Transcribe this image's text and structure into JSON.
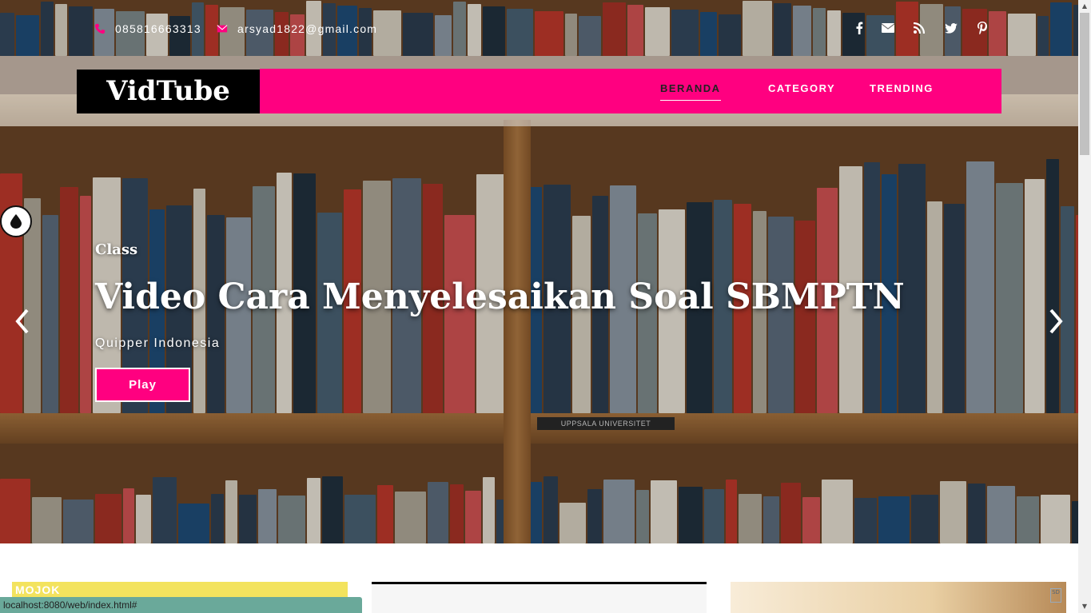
{
  "topbar": {
    "phone": "085816663313",
    "email": "arsyad1822@gmail.com",
    "social_icons": [
      "facebook-icon",
      "envelope-icon",
      "rss-icon",
      "twitter-icon",
      "pinterest-icon"
    ]
  },
  "brand": {
    "logo": "VidTube"
  },
  "nav": {
    "items": [
      {
        "label": "BERANDA",
        "active": true
      },
      {
        "label": "CATEGORY",
        "active": false
      },
      {
        "label": "TRENDING",
        "active": false
      }
    ]
  },
  "hero": {
    "category": "Class",
    "title": "Video Cara Menyelesaikan Soal SBMPTN",
    "subtitle": "Quipper Indonesia",
    "play_label": "Play",
    "shelf_label": "UPPSALA UNIVERSITET"
  },
  "cards": {
    "first_logo": "MOJOK"
  },
  "status_bar": {
    "url": "localhost:8080/web/index.html#"
  },
  "colors": {
    "accent": "#ff0080",
    "logo_bg": "#000000",
    "status_bg": "#6aa99a"
  }
}
